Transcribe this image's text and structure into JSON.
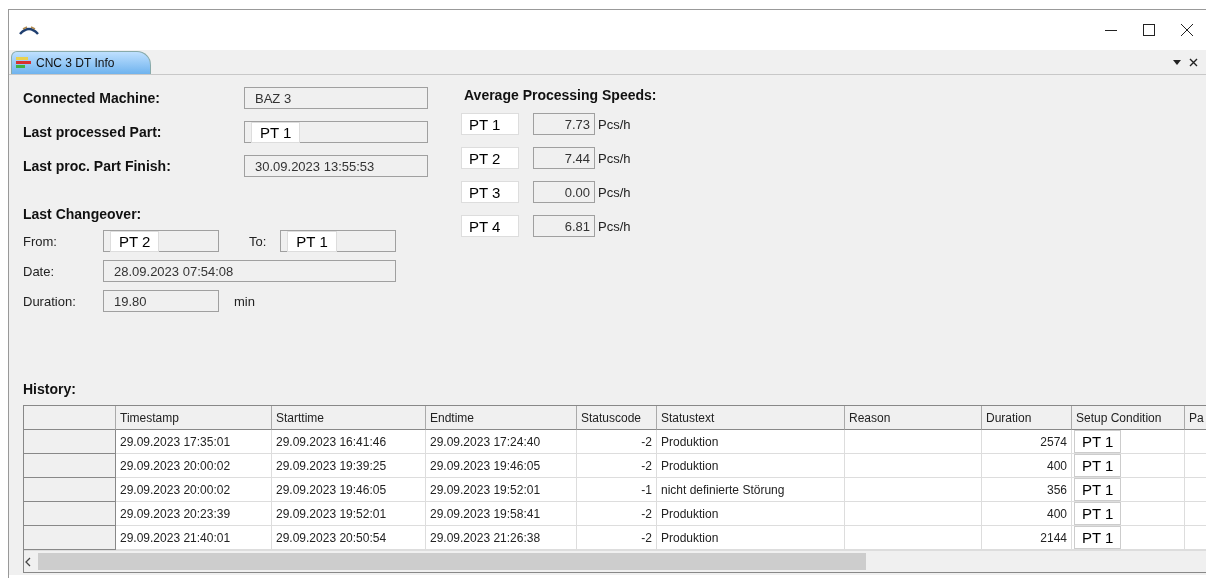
{
  "tab": {
    "label": "CNC 3 DT Info",
    "selected": true
  },
  "info_fields": [
    {
      "label": "Connected Machine:",
      "kind": "text",
      "value": "BAZ 3"
    },
    {
      "label": "Last processed Part:",
      "kind": "part",
      "value": "PT 1"
    },
    {
      "label": "Last proc. Part Finish:",
      "kind": "text",
      "value": "30.09.2023 13:55:53"
    }
  ],
  "changeover": {
    "heading": "Last Changeover:",
    "from_label": "From:",
    "from": "PT 2",
    "to_label": "To:",
    "to": "PT 1",
    "date_label": "Date:",
    "date": "28.09.2023 07:54:08",
    "duration_label": "Duration:",
    "duration": "19.80",
    "duration_unit": "min"
  },
  "speeds": {
    "heading": "Average Processing Speeds:",
    "rows": [
      {
        "part": "PT 1",
        "value": "7.73",
        "unit": "Pcs/h"
      },
      {
        "part": "PT 2",
        "value": "7.44",
        "unit": "Pcs/h"
      },
      {
        "part": "PT 3",
        "value": "0.00",
        "unit": "Pcs/h"
      },
      {
        "part": "PT 4",
        "value": "6.81",
        "unit": "Pcs/h"
      }
    ]
  },
  "history": {
    "heading": "History:",
    "columns": [
      "Timestamp",
      "Starttime",
      "Endtime",
      "Statuscode",
      "Statustext",
      "Reason",
      "Duration",
      "Setup Condition",
      "Pa"
    ],
    "rows": [
      {
        "timestamp": "29.09.2023 17:35:01",
        "starttime": "29.09.2023 16:41:46",
        "endtime": "29.09.2023 17:24:40",
        "statuscode": "-2",
        "statustext": "Produktion",
        "duration": "2574",
        "setup_condition": "PT 1"
      },
      {
        "timestamp": "29.09.2023 20:00:02",
        "starttime": "29.09.2023 19:39:25",
        "endtime": "29.09.2023 19:46:05",
        "statuscode": "-2",
        "statustext": "Produktion",
        "duration": "400",
        "setup_condition": "PT 1"
      },
      {
        "timestamp": "29.09.2023 20:00:02",
        "starttime": "29.09.2023 19:46:05",
        "endtime": "29.09.2023 19:52:01",
        "statuscode": "-1",
        "statustext": "nicht definierte Störung",
        "duration": "356",
        "setup_condition": "PT 1"
      },
      {
        "timestamp": "29.09.2023 20:23:39",
        "starttime": "29.09.2023 19:52:01",
        "endtime": "29.09.2023 19:58:41",
        "statuscode": "-2",
        "statustext": "Produktion",
        "duration": "400",
        "setup_condition": "PT 1"
      },
      {
        "timestamp": "29.09.2023 21:40:01",
        "starttime": "29.09.2023 20:50:54",
        "endtime": "29.09.2023 21:26:38",
        "statuscode": "-2",
        "statustext": "Produktion",
        "duration": "2144",
        "setup_condition": "PT 1"
      }
    ]
  }
}
